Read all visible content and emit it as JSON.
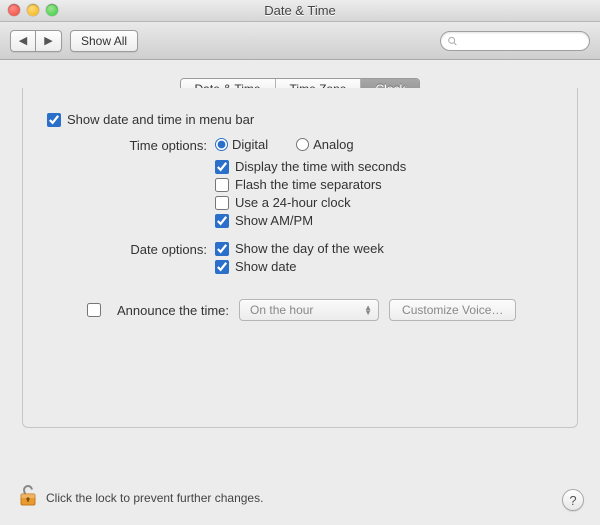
{
  "window": {
    "title": "Date & Time"
  },
  "toolbar": {
    "show_all": "Show All",
    "search_placeholder": ""
  },
  "tabs": {
    "items": [
      "Date & Time",
      "Time Zone",
      "Clock"
    ],
    "selected_index": 2
  },
  "clock": {
    "show_in_menu_bar": {
      "label": "Show date and time in menu bar",
      "checked": true
    },
    "time_options_label": "Time options:",
    "time_style": {
      "digital": {
        "label": "Digital",
        "selected": true
      },
      "analog": {
        "label": "Analog",
        "selected": false
      }
    },
    "display_seconds": {
      "label": "Display the time with seconds",
      "checked": true
    },
    "flash_separators": {
      "label": "Flash the time separators",
      "checked": false
    },
    "use_24h": {
      "label": "Use a 24-hour clock",
      "checked": false
    },
    "show_ampm": {
      "label": "Show AM/PM",
      "checked": true
    },
    "date_options_label": "Date options:",
    "show_day_of_week": {
      "label": "Show the day of the week",
      "checked": true
    },
    "show_date": {
      "label": "Show date",
      "checked": true
    },
    "announce": {
      "label": "Announce the time:",
      "checked": false,
      "interval": "On the hour",
      "customize_voice": "Customize Voice…"
    }
  },
  "footer": {
    "lock_text": "Click the lock to prevent further changes."
  }
}
